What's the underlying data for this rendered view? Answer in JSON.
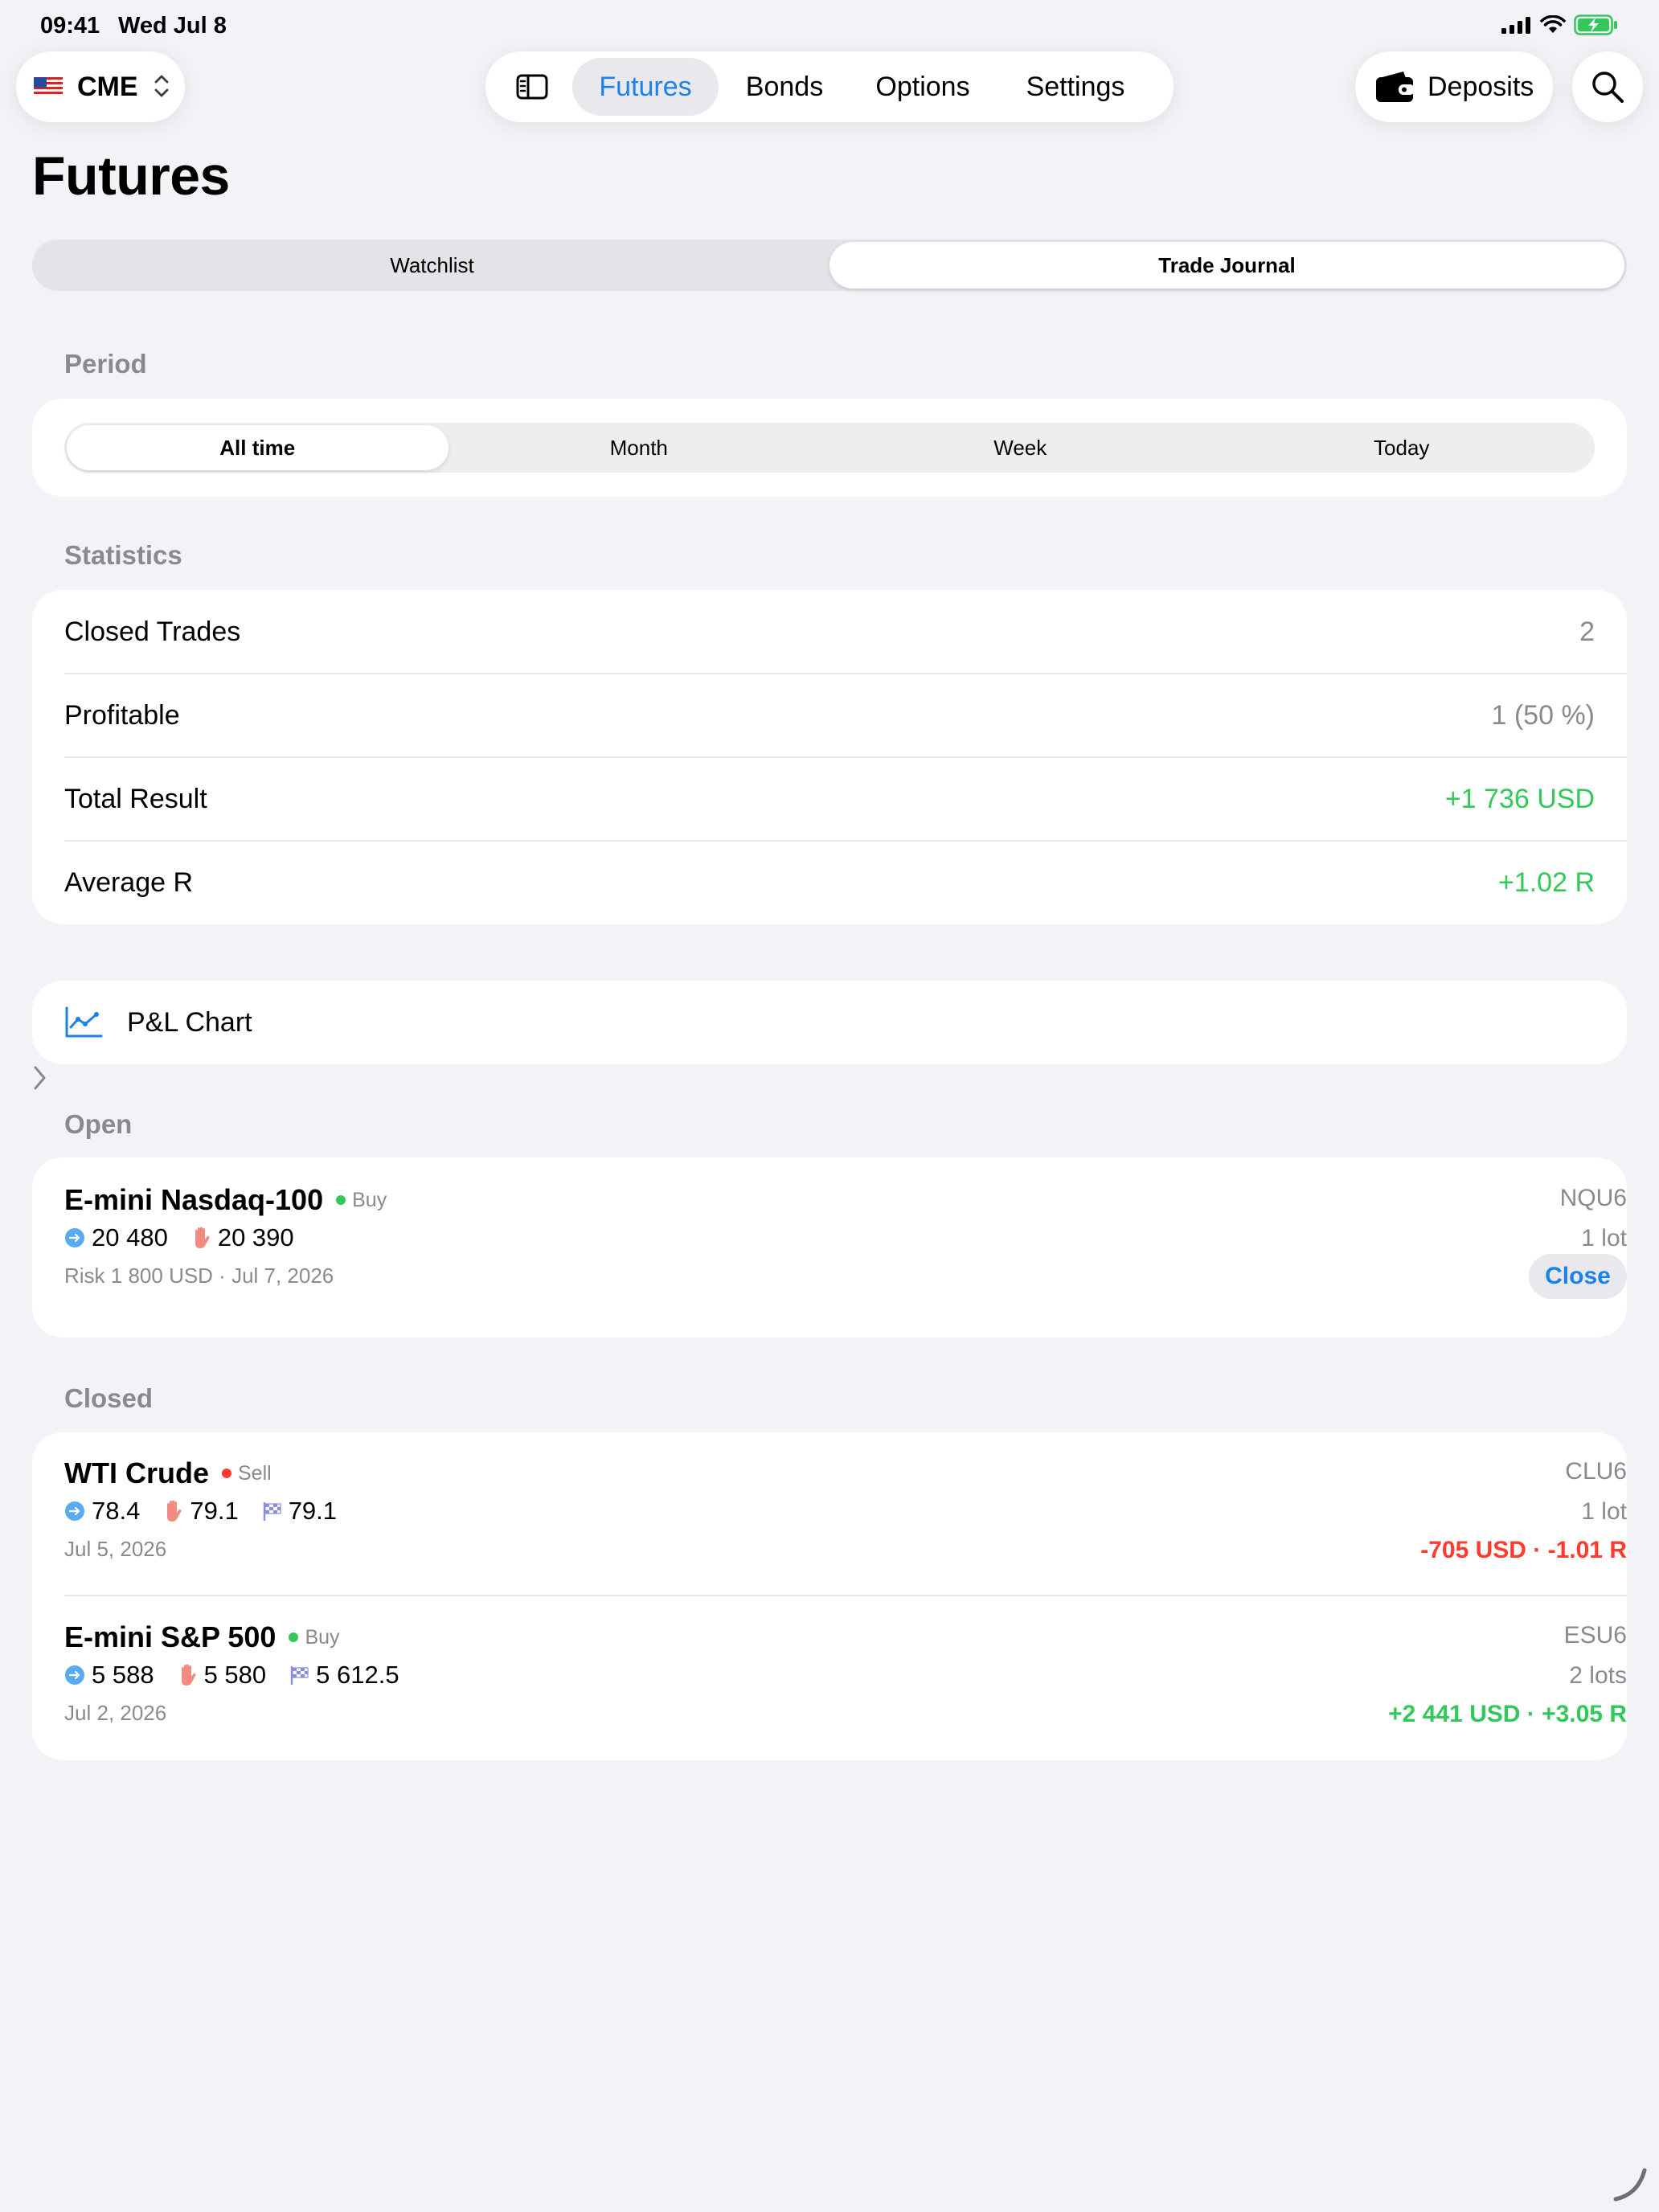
{
  "status_bar": {
    "time": "09:41",
    "date": "Wed Jul 8"
  },
  "exchange": {
    "name": "CME",
    "flag_icon": "us-flag-icon"
  },
  "tabs": [
    {
      "label": "Futures",
      "active": true
    },
    {
      "label": "Bonds"
    },
    {
      "label": "Options"
    },
    {
      "label": "Settings"
    }
  ],
  "deposits": {
    "label": "Deposits"
  },
  "page": {
    "title": "Futures"
  },
  "main_segment": {
    "options": [
      "Watchlist",
      "Trade Journal"
    ],
    "selected": "Trade Journal"
  },
  "period": {
    "section_label": "Period",
    "options": [
      "All time",
      "Month",
      "Week",
      "Today"
    ],
    "selected": "All time"
  },
  "statistics": {
    "section_label": "Statistics",
    "rows": [
      {
        "label": "Closed Trades",
        "value": "2"
      },
      {
        "label": "Profitable",
        "value": "1 (50 %)"
      },
      {
        "label": "Total Result",
        "value": "+1 736 USD"
      },
      {
        "label": "Average R",
        "value": "+1.02 R"
      }
    ]
  },
  "pnl_chart": {
    "label": "P&L Chart"
  },
  "open": {
    "section_label": "Open",
    "trades": [
      {
        "name": "E-mini Nasdaq-100",
        "side": "Buy",
        "entry": "20 480",
        "stop": "20 390",
        "meta": "Risk 1 800 USD · Jul 7, 2026",
        "ticker": "NQU6",
        "lots": "1 lot",
        "action_label": "Close"
      }
    ]
  },
  "closed": {
    "section_label": "Closed",
    "trades": [
      {
        "name": "WTI Crude",
        "side": "Sell",
        "entry": "78.4",
        "stop": "79.1",
        "exit": "79.1",
        "date": "Jul 5, 2026",
        "ticker": "CLU6",
        "lots": "1 lot",
        "result": "-705 USD · -1.01 R"
      },
      {
        "name": "E-mini S&P 500",
        "side": "Buy",
        "entry": "5 588",
        "stop": "5 580",
        "exit": "5 612.5",
        "date": "Jul 2, 2026",
        "ticker": "ESU6",
        "lots": "2 lots",
        "result": "+2 441 USD · +3.05 R"
      }
    ]
  },
  "colors": {
    "accent": "#1a82ea",
    "positive": "#34c759",
    "negative": "#ff3b30",
    "secondary_text": "#8a8a8e",
    "background": "#f2f2f7"
  }
}
